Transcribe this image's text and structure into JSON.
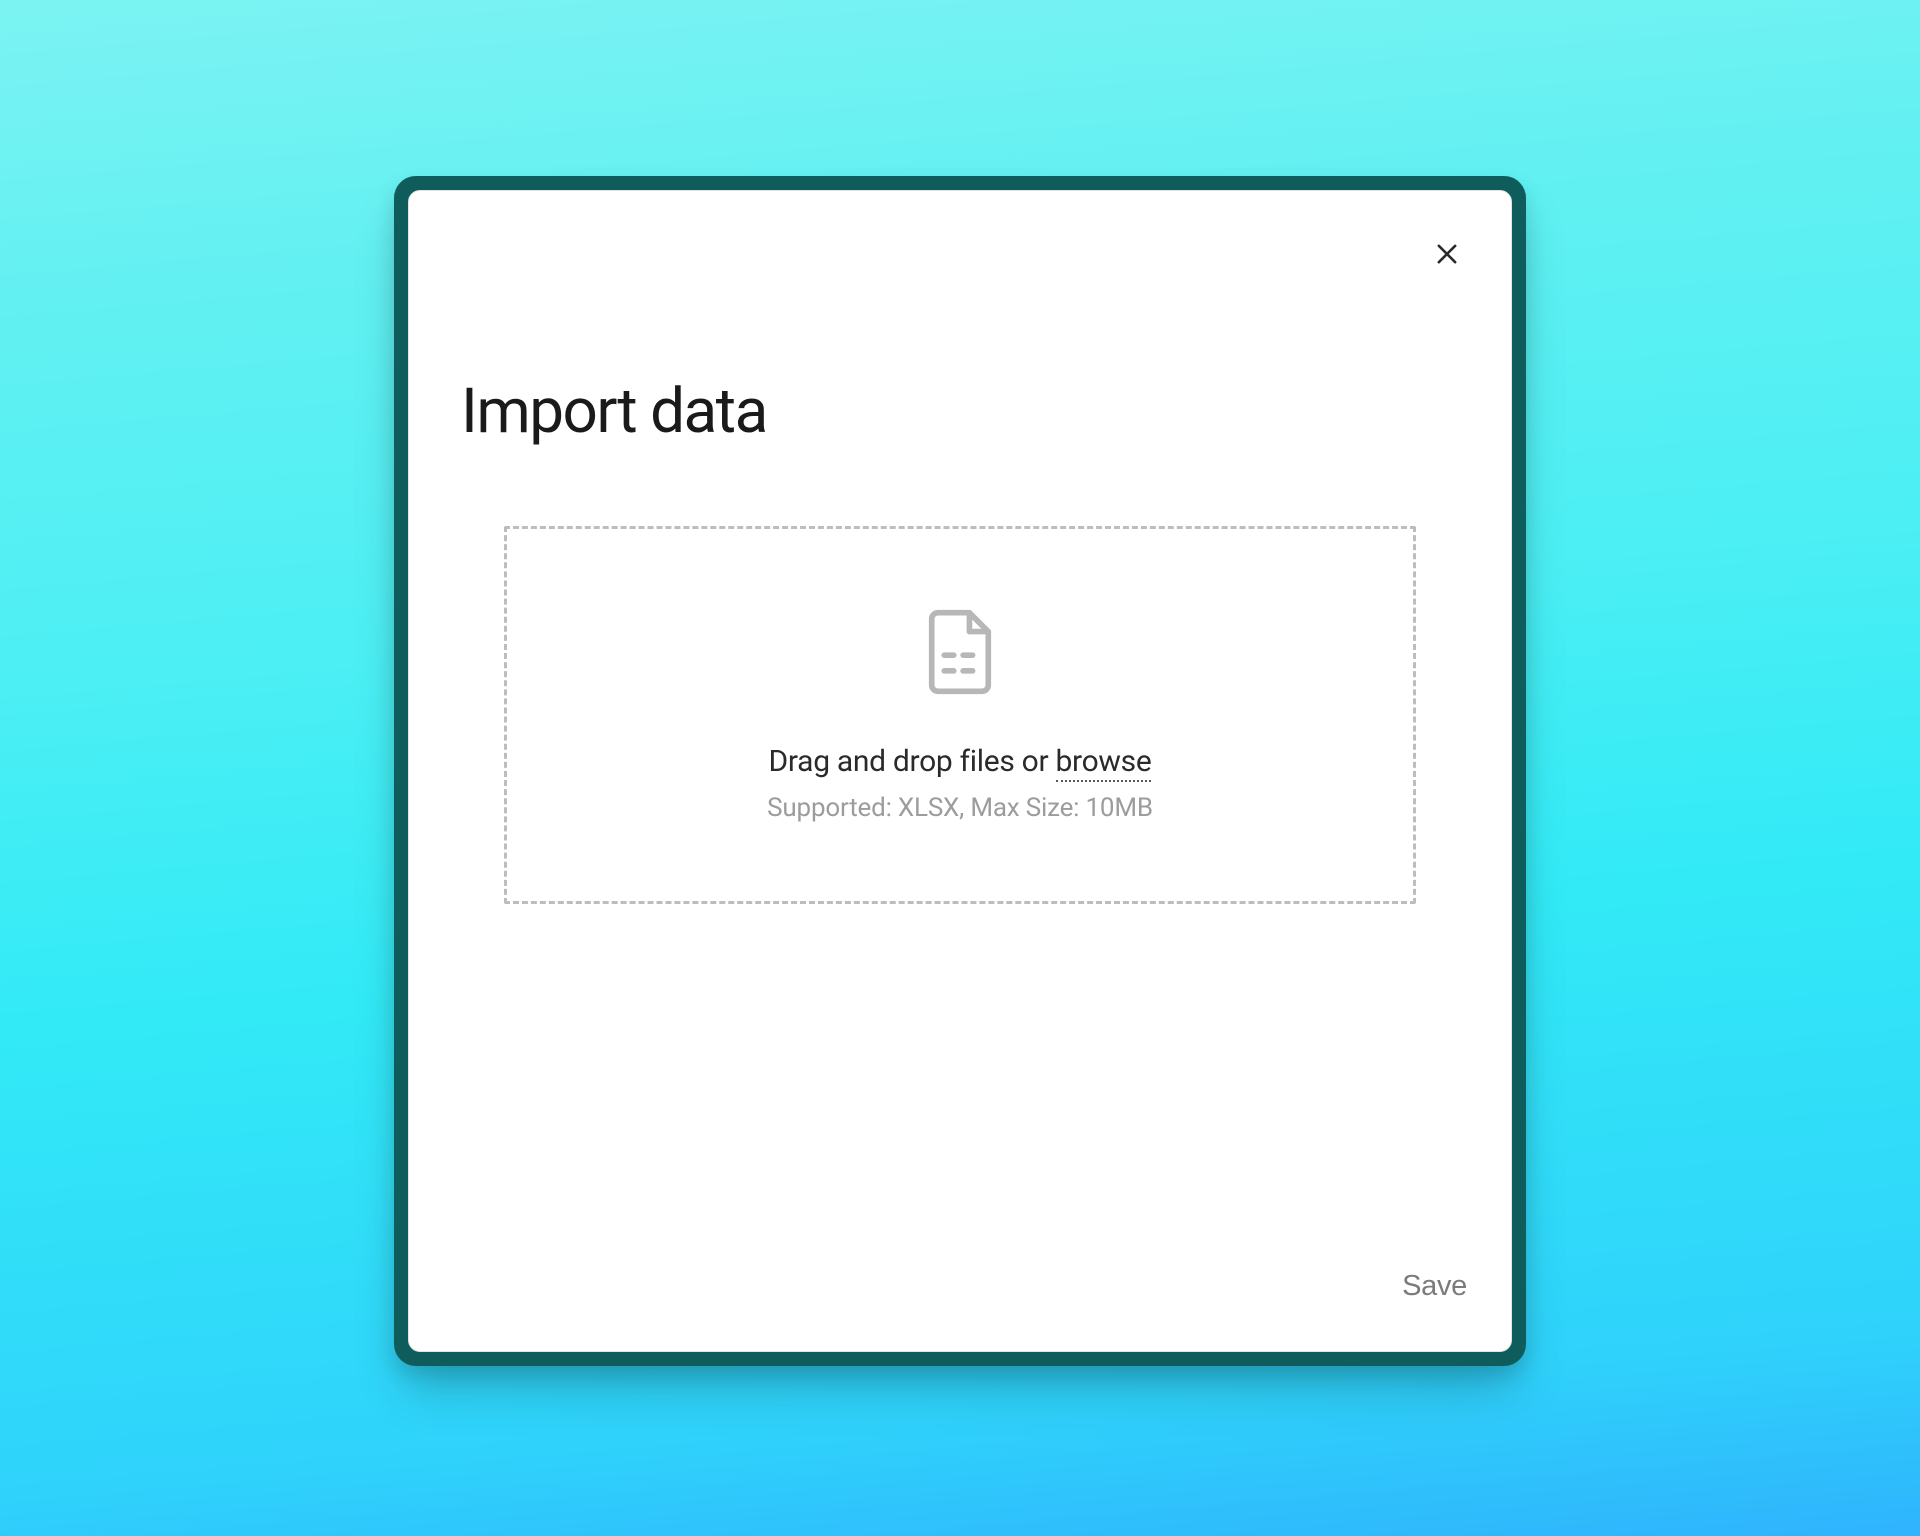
{
  "modal": {
    "title": "Import data",
    "dropzone": {
      "drag_text": "Drag and drop files or ",
      "browse_text": "browse",
      "support_text": "Supported: XLSX, Max Size: 10MB"
    },
    "save_label": "Save"
  }
}
